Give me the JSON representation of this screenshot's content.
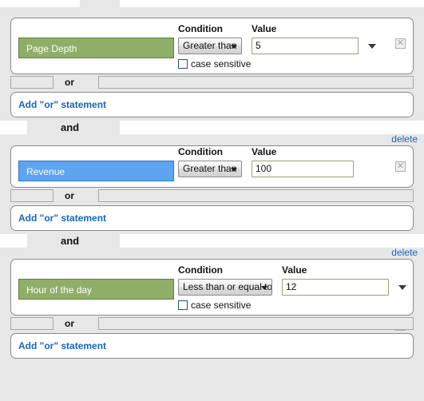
{
  "field_labels": {
    "condition": "Condition",
    "value": "Value"
  },
  "labels": {
    "case_sensitive": "case sensitive",
    "add_or_statement": "Add \"or\" statement",
    "or_word": "or",
    "and_word": "and",
    "delete_link": "delete",
    "remove_icon": "✕"
  },
  "colors": {
    "dimension_green": "#8fae68",
    "dimension_green_border": "#5f7f3c",
    "dimension_blue": "#5da5f0",
    "dimension_blue_border": "#2a78c8",
    "link_blue": "#1565c0",
    "input_border_olive": "#93a872",
    "page_background": "#e7e7e7"
  },
  "groups": [
    {
      "dimension": "Page Depth",
      "dimension_color": "green",
      "condition": "Greater than",
      "value": "5",
      "has_case_sensitive": true,
      "case_sensitive_checked": false,
      "has_value_combo_caret": true,
      "has_and_separator_above": false,
      "has_delete_link": false
    },
    {
      "dimension": "Revenue",
      "dimension_color": "blue",
      "condition": "Greater than",
      "value": "100",
      "has_case_sensitive": false,
      "case_sensitive_checked": false,
      "has_value_combo_caret": false,
      "has_and_separator_above": true,
      "has_delete_link": true
    },
    {
      "dimension": "Hour of the day",
      "dimension_color": "green",
      "condition": "Less than or equal to",
      "value": "12",
      "has_case_sensitive": true,
      "case_sensitive_checked": false,
      "has_value_combo_caret": true,
      "has_and_separator_above": true,
      "has_delete_link": true
    }
  ]
}
